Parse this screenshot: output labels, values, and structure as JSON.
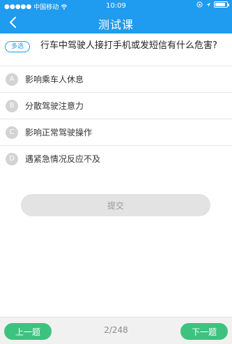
{
  "status_bar": {
    "carrier": "中国移动",
    "time": "10:09",
    "battery_level": 0.9,
    "icons": [
      "signal-dots-icon",
      "wifi-icon",
      "lock-rotation-icon",
      "location-icon",
      "battery-icon"
    ]
  },
  "header": {
    "title": "测试课",
    "back_icon": "chevron-left-icon"
  },
  "question": {
    "type_tag": "多选",
    "text": "行车中驾驶人接打手机或发短信有什么危害?"
  },
  "options": [
    {
      "letter": "A",
      "text": "影响乘车人休息"
    },
    {
      "letter": "B",
      "text": "分散驾驶注意力"
    },
    {
      "letter": "C",
      "text": "影响正常驾驶操作"
    },
    {
      "letter": "D",
      "text": "遇紧急情况反应不及"
    }
  ],
  "submit_label": "提交",
  "footer": {
    "prev_label": "上一题",
    "page_counter": "2/248",
    "next_label": "下一题"
  },
  "colors": {
    "accent": "#1f9bf0",
    "nav_button": "#3ec27f",
    "option_circle": "#d3d3d3"
  }
}
